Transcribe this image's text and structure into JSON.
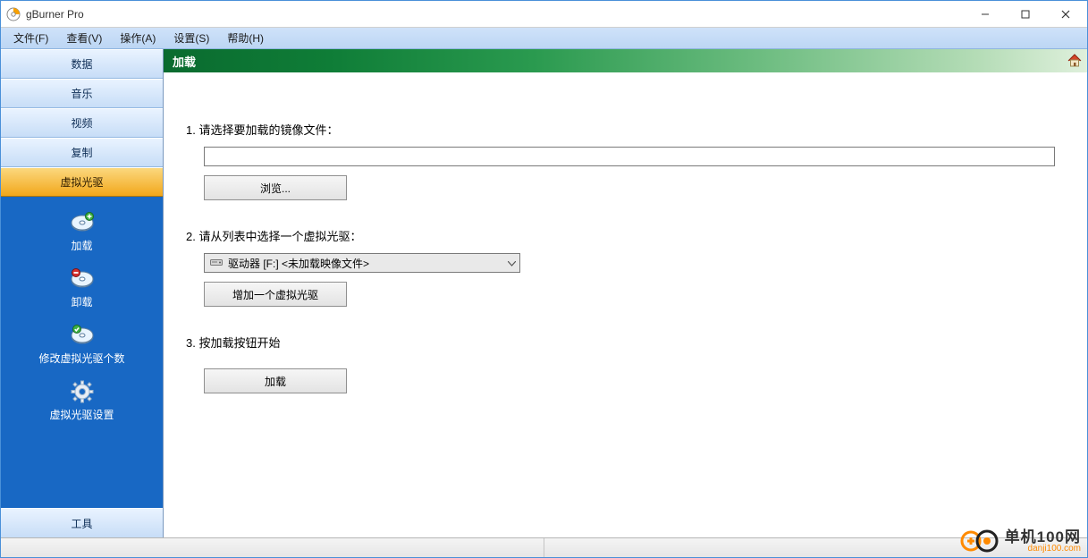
{
  "window": {
    "title": "gBurner Pro",
    "controls": {
      "minimize": "−",
      "maximize": "☐",
      "close": "✕"
    }
  },
  "menu_bar": {
    "items": [
      "文件(F)",
      "查看(V)",
      "操作(A)",
      "设置(S)",
      "帮助(H)"
    ]
  },
  "sidebar": {
    "categories": [
      {
        "label": "数据",
        "active": false
      },
      {
        "label": "音乐",
        "active": false
      },
      {
        "label": "视频",
        "active": false
      },
      {
        "label": "复制",
        "active": false
      },
      {
        "label": "虚拟光驱",
        "active": true
      }
    ],
    "tasks": [
      {
        "label": "加载",
        "icon": "disc-mount-icon"
      },
      {
        "label": "卸载",
        "icon": "disc-unmount-icon"
      },
      {
        "label": "修改虚拟光驱个数",
        "icon": "disc-count-icon"
      },
      {
        "label": "虚拟光驱设置",
        "icon": "gear-icon"
      }
    ],
    "bottom": {
      "label": "工具"
    }
  },
  "panel": {
    "title": "加载",
    "step1_label": "1. 请选择要加载的镜像文件：",
    "image_path": "",
    "browse_label": "浏览...",
    "step2_label": "2. 请从列表中选择一个虚拟光驱：",
    "drive_selected": "驱动器 [F:] <未加载映像文件>",
    "add_drive_label": "增加一个虚拟光驱",
    "step3_label": "3. 按加载按钮开始",
    "mount_label": "加载"
  },
  "watermark": {
    "main": "单机100网",
    "sub": "danji100.com"
  }
}
